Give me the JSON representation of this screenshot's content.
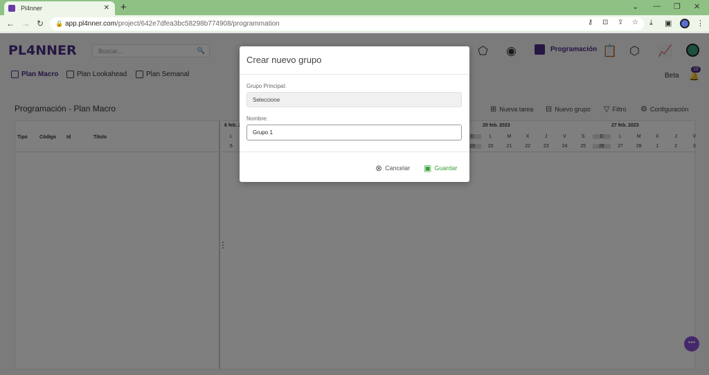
{
  "browser": {
    "tab_title": "Pl4nner",
    "new_tab": "+",
    "url_host": "app.pl4nner.com",
    "url_path": "/project/642e7dfea3bc58298b774908/programmation"
  },
  "app": {
    "logo": "PL4NNER",
    "search_placeholder": "Buscar...",
    "nav_active_label": "Programación",
    "subnav": [
      "Plan Macro",
      "Plan Lookahead",
      "Plan Semanal"
    ],
    "beta": "Beta",
    "notif_count": "10",
    "page_title": "Programación - Plan Macro",
    "actions": {
      "new_task": "Nueva tarea",
      "new_group": "Nuevo grupo",
      "filter": "Filtro",
      "config": "Configuración"
    },
    "columns": [
      "Tipo",
      "Código",
      "Id",
      "Título"
    ],
    "calendar": {
      "weeks": [
        "6 feb. 2",
        "20 feb. 2023",
        "27 feb. 2023"
      ],
      "first_day_letter": "L",
      "first_day_num": "6",
      "days_week3": {
        "letters": [
          "D",
          "L",
          "M",
          "X",
          "J",
          "V",
          "S",
          "D"
        ],
        "nums": [
          "19",
          "20",
          "21",
          "22",
          "23",
          "24",
          "25",
          "26"
        ]
      },
      "days_week4": {
        "letters": [
          "L",
          "M",
          "X",
          "J",
          "V"
        ],
        "nums": [
          "27",
          "28",
          "1",
          "2",
          "3"
        ]
      }
    }
  },
  "modal": {
    "title": "Crear nuevo grupo",
    "parent_label": "Grupo Principal:",
    "parent_value": "Seleccione",
    "name_label": "Nombre:",
    "name_value": "Grupo 1",
    "cancel": "Cancelar",
    "save": "Guardar"
  },
  "colors": {
    "brand": "#4a2c86",
    "save": "#3aa03a",
    "browser_tabbar": "#8fc184"
  }
}
